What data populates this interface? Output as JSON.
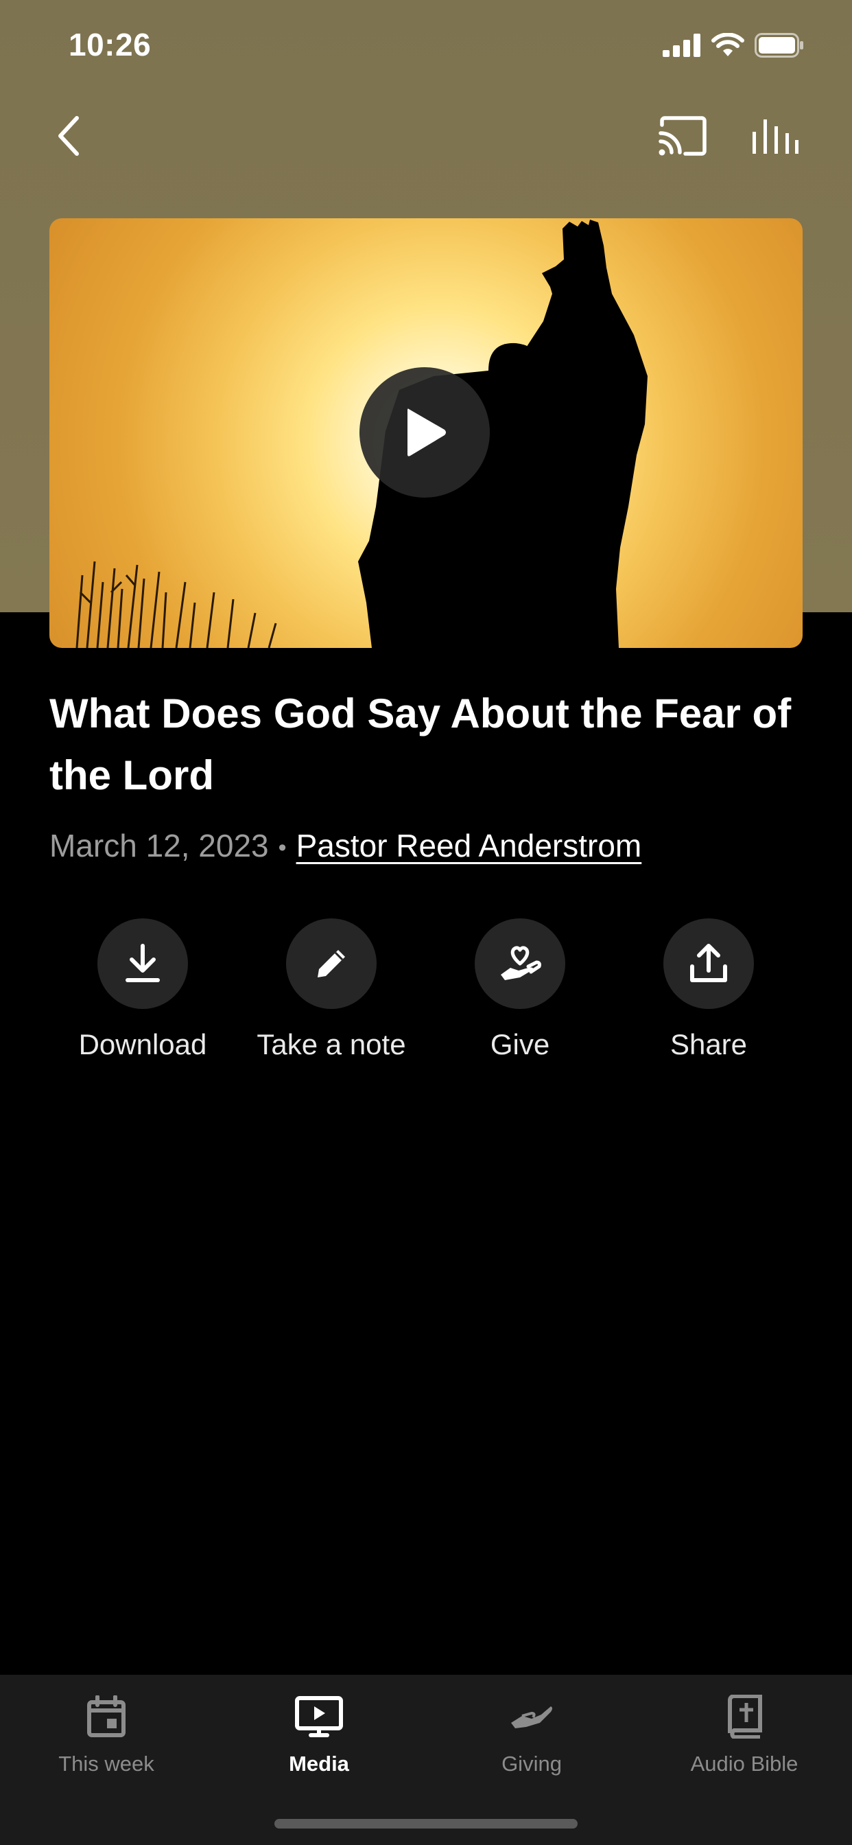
{
  "status_bar": {
    "time": "10:26"
  },
  "nav": {
    "back_icon": "chevron-left-icon",
    "cast_icon": "cast-icon",
    "audio_icon": "audio-bars-icon"
  },
  "media": {
    "title": "What Does God Say About the Fear of the Lord",
    "date": "March 12, 2023",
    "separator": "•",
    "author": "Pastor Reed Anderstrom"
  },
  "actions": [
    {
      "label": "Download",
      "icon": "download-icon"
    },
    {
      "label": "Take a note",
      "icon": "pencil-icon"
    },
    {
      "label": "Give",
      "icon": "hand-heart-icon"
    },
    {
      "label": "Share",
      "icon": "share-icon"
    }
  ],
  "tabs": [
    {
      "label": "This week",
      "icon": "calendar-icon",
      "active": false
    },
    {
      "label": "Media",
      "icon": "monitor-play-icon",
      "active": true
    },
    {
      "label": "Giving",
      "icon": "giving-hand-icon",
      "active": false
    },
    {
      "label": "Audio Bible",
      "icon": "bible-icon",
      "active": false
    }
  ],
  "colors": {
    "header_bg": "#7e7350",
    "background": "#000000",
    "tabbar_bg": "#1b1b1b",
    "action_circle": "#262626",
    "inactive_tab": "#8c8c8c"
  }
}
